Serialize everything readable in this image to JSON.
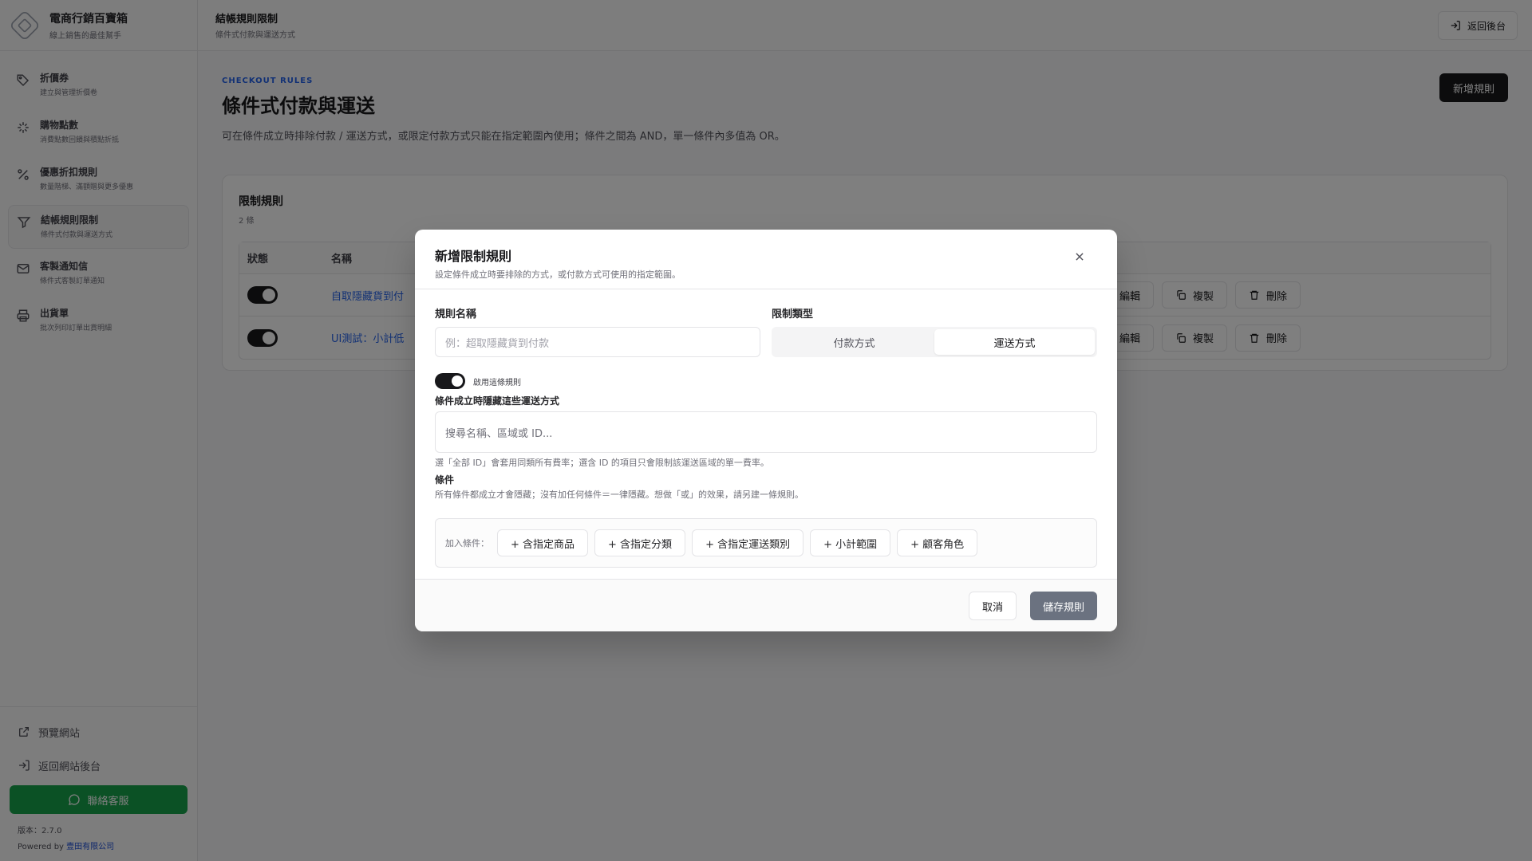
{
  "brand": {
    "title": "電商行銷百寶箱",
    "subtitle": "線上銷售的最佳幫手"
  },
  "sidebar": {
    "items": [
      {
        "label": "折價券",
        "desc": "建立與管理折價卷",
        "icon": "tag-icon"
      },
      {
        "label": "購物點數",
        "desc": "消費點數回饋與積點折抵",
        "icon": "sparkle-icon"
      },
      {
        "label": "優惠折扣規則",
        "desc": "數量階梯、滿額贈與更多優惠",
        "icon": "percent-icon"
      },
      {
        "label": "結帳規則限制",
        "desc": "條件式付款與運送方式",
        "icon": "filter-icon"
      },
      {
        "label": "客製通知信",
        "desc": "條件式客製訂單通知",
        "icon": "mail-icon"
      },
      {
        "label": "出貨單",
        "desc": "批次列印訂單出貨明細",
        "icon": "printer-icon"
      }
    ],
    "bottom": {
      "preview": "預覽網站",
      "back_admin": "返回網站後台",
      "contact": "聯絡客服",
      "version": "版本：2.7.0",
      "powered_prefix": "Powered by ",
      "powered_company": "壹田有限公司"
    }
  },
  "header": {
    "title": "結帳規則限制",
    "subtitle": "條件式付款與運送方式",
    "back_button": "返回後台"
  },
  "main": {
    "eyebrow": "CHECKOUT RULES",
    "title": "條件式付款與運送",
    "description": "可在條件成立時排除付款 / 運送方式，或限定付款方式只能在指定範圍內使用；條件之間為 AND，單一條件內多值為 OR。",
    "new_rule_button": "新增規則",
    "card": {
      "title": "限制規則",
      "count": "2 條",
      "columns": {
        "status": "狀態",
        "name": "名稱"
      },
      "rows": [
        {
          "enabled": true,
          "name": "自取隱藏貨到付"
        },
        {
          "enabled": true,
          "name": "UI測試：小計低"
        }
      ],
      "actions": {
        "edit": "編輯",
        "copy": "複製",
        "delete": "刪除"
      }
    }
  },
  "modal": {
    "title": "新增限制規則",
    "subtitle": "設定條件成立時要排除的方式，或付款方式可使用的指定範圍。",
    "rule_name_label": "規則名稱",
    "rule_name_placeholder": "例：超取隱藏貨到付款",
    "type_label": "限制類型",
    "type_options": [
      "付款方式",
      "運送方式"
    ],
    "type_selected": "運送方式",
    "enable_label": "啟用這條規則",
    "enabled": true,
    "hide_label": "條件成立時隱藏這些運送方式",
    "search_placeholder": "搜尋名稱、區域或 ID...",
    "hide_hint": "選「全部 ID」會套用同類所有費率；選含 ID 的項目只會限制該運送區域的單一費率。",
    "conditions_label": "條件",
    "conditions_hint": "所有條件都成立才會隱藏；沒有加任何條件＝一律隱藏。想做「或」的效果，請另建一條規則。",
    "add_condition_label": "加入條件：",
    "condition_buttons": [
      "+ 含指定商品",
      "+ 含指定分類",
      "+ 含指定運送類別",
      "+ 小計範圍",
      "+ 顧客角色"
    ],
    "cancel": "取消",
    "save": "儲存規則"
  }
}
